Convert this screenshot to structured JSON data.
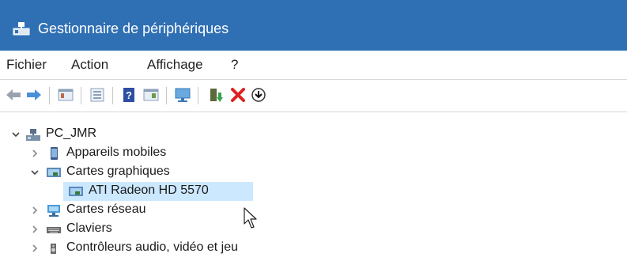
{
  "window": {
    "title": "Gestionnaire de périphériques"
  },
  "menu": {
    "items": [
      "Fichier",
      "Action",
      "Affichage",
      "?"
    ]
  },
  "toolbar": {
    "buttons": [
      {
        "icon": "back-arrow-icon"
      },
      {
        "icon": "forward-arrow-icon"
      },
      {
        "icon": "properties-icon"
      },
      {
        "icon": "console-view-icon"
      },
      {
        "icon": "help-icon"
      },
      {
        "icon": "action-pane-icon"
      },
      {
        "icon": "scan-hardware-icon"
      },
      {
        "icon": "update-driver-icon"
      },
      {
        "icon": "uninstall-icon"
      },
      {
        "icon": "download-icon"
      }
    ]
  },
  "tree": {
    "root": {
      "label": "PC_JMR",
      "expanded": true
    },
    "items": [
      {
        "label": "Appareils mobiles",
        "expanded": false,
        "icon": "mobile-device-icon"
      },
      {
        "label": "Cartes graphiques",
        "expanded": true,
        "icon": "display-adapter-icon"
      },
      {
        "label": "ATI Radeon HD 5570",
        "child": true,
        "selected": true,
        "icon": "display-adapter-icon"
      },
      {
        "label": "Cartes réseau",
        "expanded": false,
        "icon": "network-adapter-icon"
      },
      {
        "label": "Claviers",
        "expanded": false,
        "icon": "keyboard-icon"
      },
      {
        "label": "Contrôleurs audio, vidéo et jeu",
        "expanded": false,
        "icon": "speaker-icon"
      }
    ]
  },
  "colors": {
    "titlebar": "#2f6fb3",
    "selection": "#cce8ff",
    "uninstall_red": "#e02020"
  }
}
